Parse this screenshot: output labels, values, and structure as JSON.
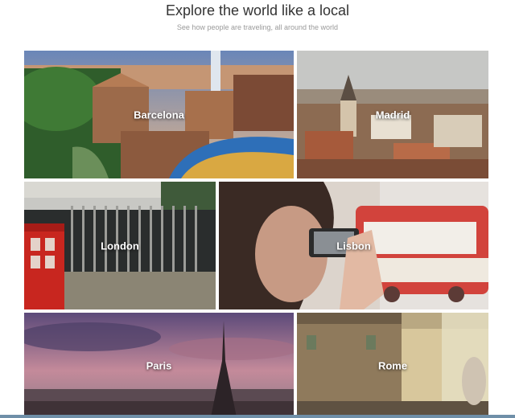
{
  "header": {
    "title": "Explore the world like a local",
    "subtitle": "See how people are traveling, all around the world"
  },
  "cities": [
    {
      "name": "Barcelona"
    },
    {
      "name": "Madrid"
    },
    {
      "name": "London"
    },
    {
      "name": "Lisbon"
    },
    {
      "name": "Paris"
    },
    {
      "name": "Rome"
    }
  ]
}
